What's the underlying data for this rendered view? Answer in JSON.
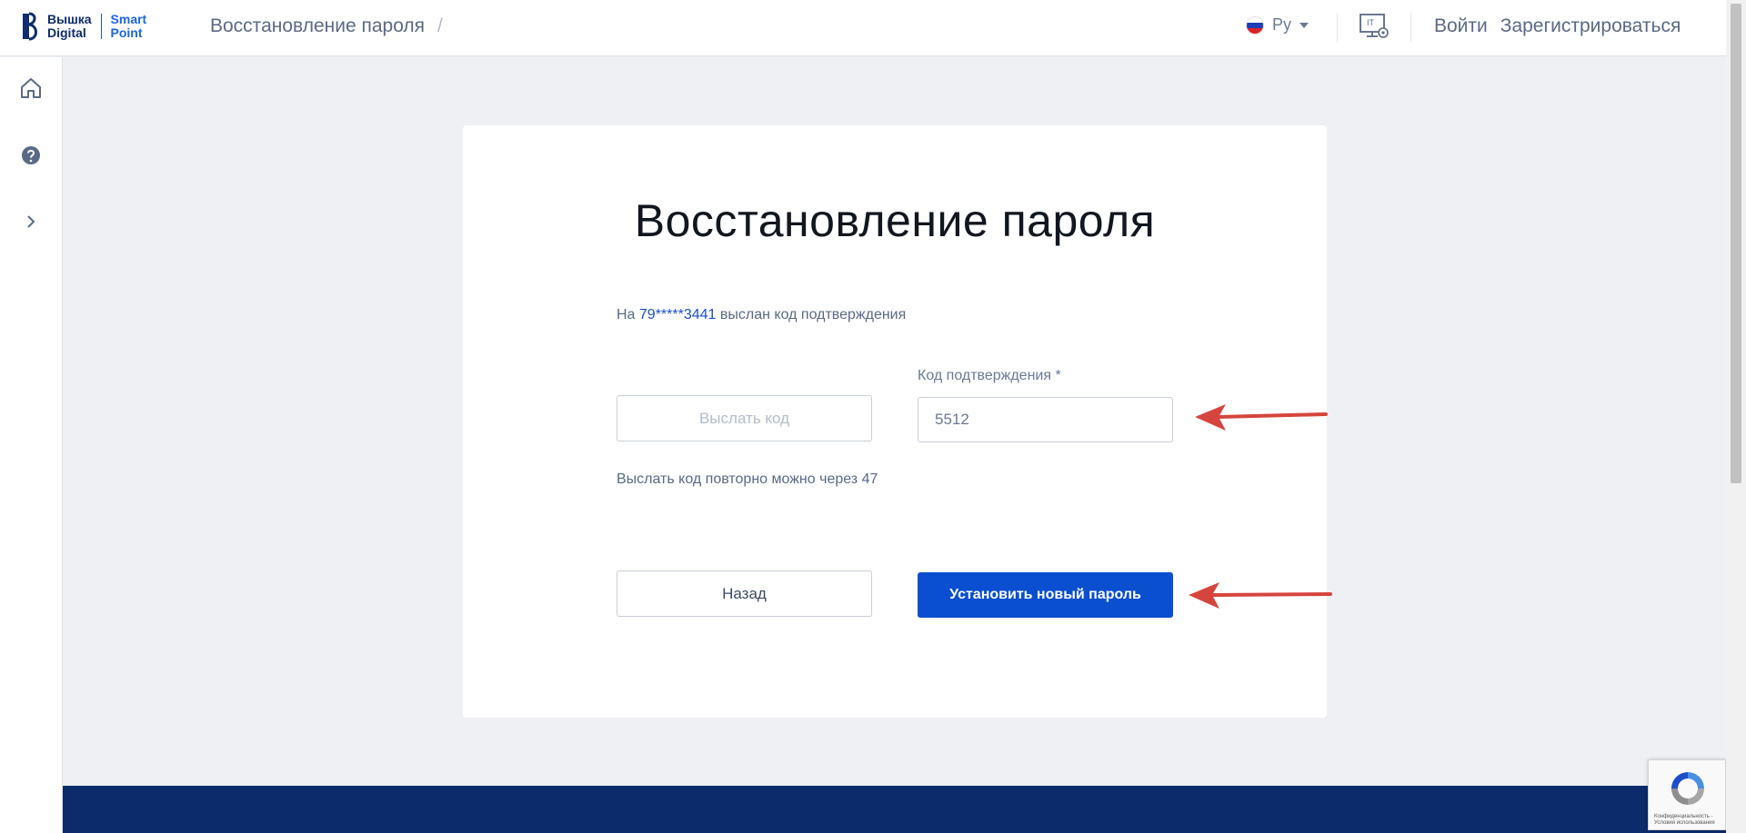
{
  "header": {
    "logo": {
      "line1": "Вышка",
      "line2": "Digital",
      "line3": "Smart",
      "line4": "Point"
    },
    "breadcrumb": {
      "current": "Восстановление пароля",
      "separator": "/"
    },
    "language": {
      "label": "Ру",
      "flag_colors": [
        "#ffffff",
        "#1c3fb7",
        "#d8232a"
      ]
    },
    "it_icon": "it-settings-icon",
    "login_label": "Войти",
    "register_label": "Зарегистрироваться"
  },
  "sidebar": {
    "items": [
      {
        "icon": "home-icon"
      },
      {
        "icon": "help-icon"
      },
      {
        "icon": "chevron-right-icon"
      }
    ]
  },
  "card": {
    "title": "Восстановление пароля",
    "info_prefix": "На",
    "phone": "79*****3441",
    "info_suffix": "выслан код подтверждения",
    "send_code_label": "Выслать код",
    "code_label": "Код подтверждения *",
    "code_value": "5512",
    "resend_text": "Выслать код повторно можно через 47",
    "back_label": "Назад",
    "submit_label": "Установить новый пароль"
  },
  "recaptcha": {
    "text": "Конфиденциальность - Условия использования"
  },
  "colors": {
    "primary": "#0b4fd1",
    "footer": "#0c2b6b",
    "background": "#eef0f4",
    "arrow": "#d6453d"
  }
}
